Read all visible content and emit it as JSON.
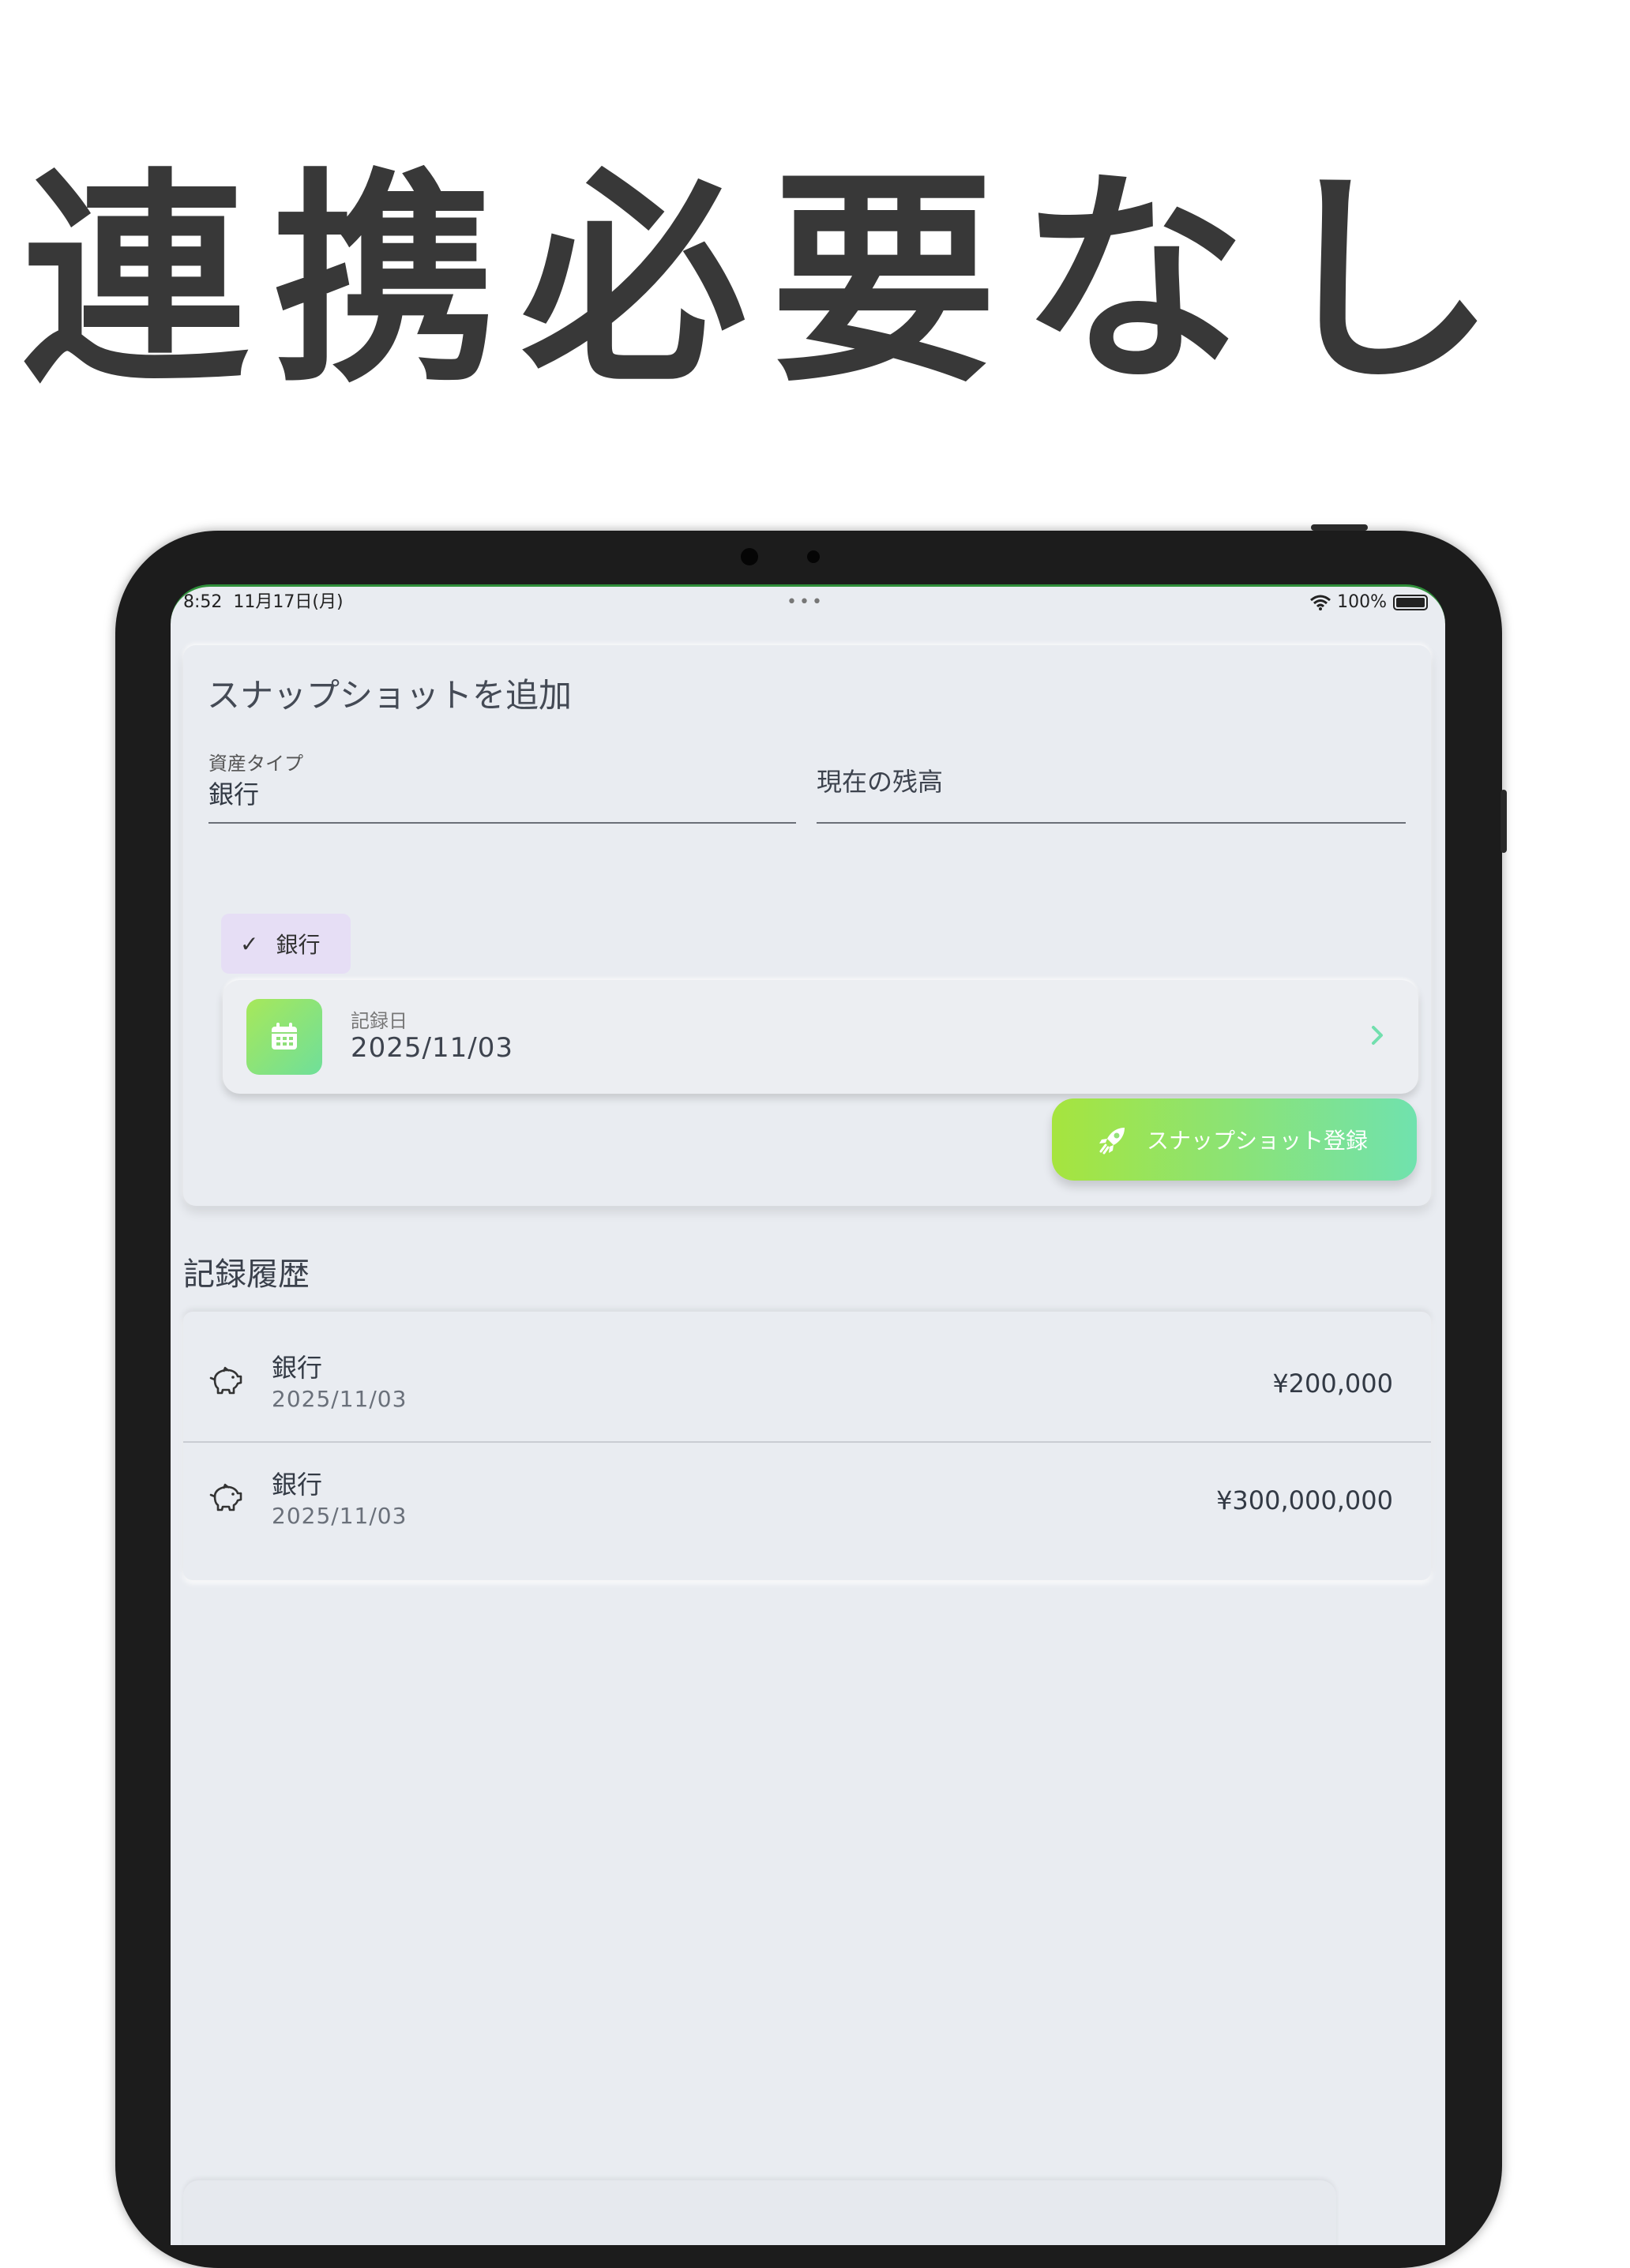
{
  "headline": "連携必要なし",
  "status_bar": {
    "time": "8:52",
    "date": "11月17日(月)",
    "multitask_dots": "•••",
    "battery": "100%"
  },
  "form": {
    "title": "スナップショットを追加",
    "asset_type": {
      "label": "資産タイプ",
      "value": "銀行"
    },
    "balance": {
      "placeholder": "現在の残高"
    },
    "chip_label": "銀行",
    "date_field": {
      "label": "記録日",
      "value": "2025/11/03"
    },
    "submit_label": "スナップショット登録"
  },
  "history": {
    "title": "記録履歴",
    "items": [
      {
        "name": "銀行",
        "date": "2025/11/03",
        "amount": "¥200,000"
      },
      {
        "name": "銀行",
        "date": "2025/11/03",
        "amount": "¥300,000,000"
      }
    ]
  },
  "colors": {
    "accent_start": "#a6e43e",
    "accent_end": "#70e2ae",
    "chip_bg": "#e6def5",
    "screen_bg": "#e9ecf1"
  },
  "icons": {
    "calendar": "calendar-icon",
    "rocket": "rocket-icon",
    "piggy_bank": "piggy-bank-icon",
    "chevron": "chevron-right-icon",
    "check": "check-icon",
    "wifi": "wifi-icon",
    "battery": "battery-icon"
  }
}
